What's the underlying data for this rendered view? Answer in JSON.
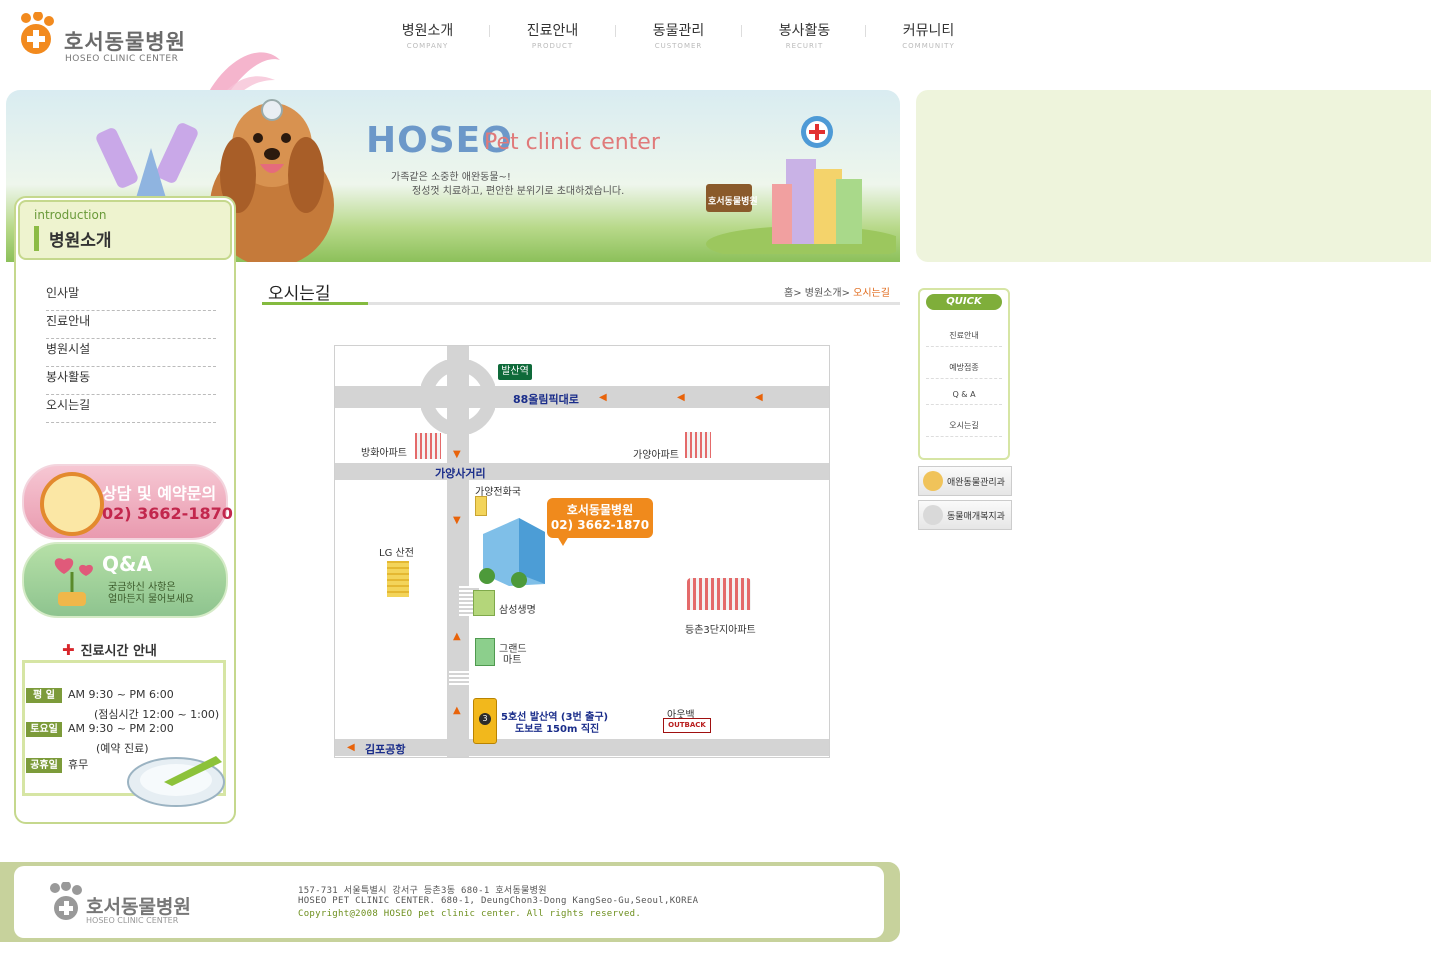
{
  "header": {
    "logo_ko": "호서동물병원",
    "logo_en": "HOSEO CLINIC CENTER",
    "nav": [
      {
        "ko": "병원소개",
        "en": "COMPANY"
      },
      {
        "ko": "진료안내",
        "en": "PRODUCT"
      },
      {
        "ko": "동물관리",
        "en": "CUSTOMER"
      },
      {
        "ko": "봉사활동",
        "en": "RECURIT"
      },
      {
        "ko": "커뮤니티",
        "en": "COMMUNITY"
      }
    ]
  },
  "banner": {
    "title_main": "HOSEO",
    "title_sub": "Pet clinic center",
    "line1": "가족같은 소중한 애완동물~!",
    "line2": "정성껏 치료하고, 편안한 분위기로 초대하겠습니다.",
    "sign": "호서동물병원"
  },
  "sidebar": {
    "intro": "introduction",
    "title": "병원소개",
    "menu": [
      "인사말",
      "진료안내",
      "병원시설",
      "봉사활동",
      "오시는길"
    ],
    "promo_consult": {
      "title": "상담 및 예약문의",
      "phone": "02) 3662-1870"
    },
    "promo_qa": {
      "title": "Q&A",
      "line1": "궁금하신 사항은",
      "line2": "얼마든지 물어보세요"
    },
    "hours": {
      "title": "진료시간 안내",
      "rows": [
        {
          "badge": "평  일",
          "text": "AM 9:30 ~ PM 6:00",
          "note": "(점심시간 12:00 ~ 1:00)"
        },
        {
          "badge": "토요일",
          "text": "AM 9:30 ~ PM 2:00",
          "note": "(예약 진료)"
        },
        {
          "badge": "공휴일",
          "text": "휴무",
          "note": ""
        }
      ]
    }
  },
  "content": {
    "title": "오시는길",
    "breadcrumb": {
      "home": "홈>",
      "section": "병원소개>",
      "current": "오시는길"
    }
  },
  "map": {
    "station_top": "발산역",
    "road_main": "88올림픽대로",
    "road_cross": "가양사거리",
    "apt_left": "방화아파트",
    "apt_right": "가양아파트",
    "phone_office": "가양전화국",
    "callout_name": "호서동물병원",
    "callout_phone": "02) 3662-1870",
    "lg": "LG 산전",
    "samsung": "삼성생명",
    "grand1": "그랜드",
    "grand2": "마트",
    "apt_dc": "등촌3단지아파트",
    "subway1": "5호선 발산역 (3번 출구)",
    "subway2": "도보로 150m 직진",
    "subway_num": "3",
    "outback_label": "아웃백",
    "outback_logo": "OUTBACK",
    "airport": "김포공항"
  },
  "quick": {
    "head": "QUICK",
    "items": [
      "진료안내",
      "예방접종",
      "Q & A",
      "오시는길"
    ],
    "btn1": "애완동물관리과",
    "btn2": "동물매개복지과"
  },
  "footer": {
    "logo_ko": "호서동물병원",
    "logo_en": "HOSEO CLINIC CENTER",
    "addr_ko": "157-731 서울특별시 강서구 등촌3동 680-1 호서동물병원",
    "addr_en": "HOSEO PET CLINIC CENTER. 680-1, DeungChon3-Dong KangSeo-Gu,Seoul,KOREA",
    "copyright": "Copyright@2008 HOSEO pet clinic center. All rights reserved."
  },
  "colors": {
    "accent_green": "#84ba3f",
    "accent_orange": "#e8630a",
    "map_blue": "#1a2d8a"
  }
}
